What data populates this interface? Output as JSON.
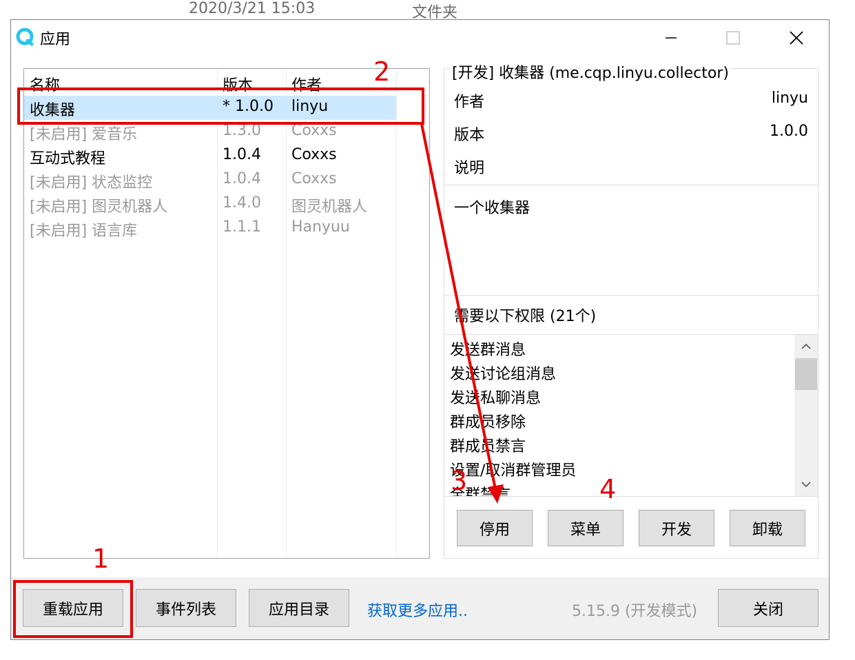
{
  "background": {
    "datetime": "2020/3/21 15:03",
    "type": "文件夹"
  },
  "window": {
    "title": "应用",
    "icon": "app-logo-icon",
    "controls": [
      "minimize-icon",
      "maximize-icon",
      "close-icon"
    ]
  },
  "app_list": {
    "columns": [
      "名称",
      "版本",
      "作者"
    ],
    "rows": [
      {
        "name": "收集器",
        "version": "* 1.0.0",
        "author": "linyu",
        "selected": true,
        "enabled": true
      },
      {
        "name": "[未启用] 爱音乐",
        "version": "1.3.0",
        "author": "Coxxs",
        "selected": false,
        "enabled": false
      },
      {
        "name": "互动式教程",
        "version": "1.0.4",
        "author": "Coxxs",
        "selected": false,
        "enabled": true
      },
      {
        "name": "[未启用] 状态监控",
        "version": "1.0.4",
        "author": "Coxxs",
        "selected": false,
        "enabled": false
      },
      {
        "name": "[未启用] 图灵机器人",
        "version": "1.4.0",
        "author": "图灵机器人",
        "selected": false,
        "enabled": false
      },
      {
        "name": "[未启用] 语言库",
        "version": "1.1.1",
        "author": "Hanyuu",
        "selected": false,
        "enabled": false
      }
    ]
  },
  "detail": {
    "group_title": "[开发] 收集器 (me.cqp.linyu.collector)",
    "author_label": "作者",
    "author_value": "linyu",
    "version_label": "版本",
    "version_value": "1.0.0",
    "desc_label": "说明",
    "description": "一个收集器",
    "permissions_header": "需要以下权限 (21个)",
    "permissions": [
      "发送群消息",
      "发送讨论组消息",
      "发送私聊消息",
      "群成员移除",
      "群成员禁言",
      "设置/取消群管理员",
      "全群禁言"
    ],
    "buttons": {
      "disable": "停用",
      "menu": "菜单",
      "dev": "开发",
      "uninstall": "卸载"
    }
  },
  "footer": {
    "reload": "重载应用",
    "events": "事件列表",
    "app_dir": "应用目录",
    "more_link": "获取更多应用..",
    "version": "5.15.9 (开发模式)",
    "close": "关闭"
  },
  "annotations": {
    "labels": [
      "1",
      "2",
      "3",
      "4"
    ],
    "color": "#e60000"
  },
  "colors": {
    "selection": "#cce8ff",
    "link": "#0066cc",
    "disabled_text": "#9a9a9a"
  }
}
